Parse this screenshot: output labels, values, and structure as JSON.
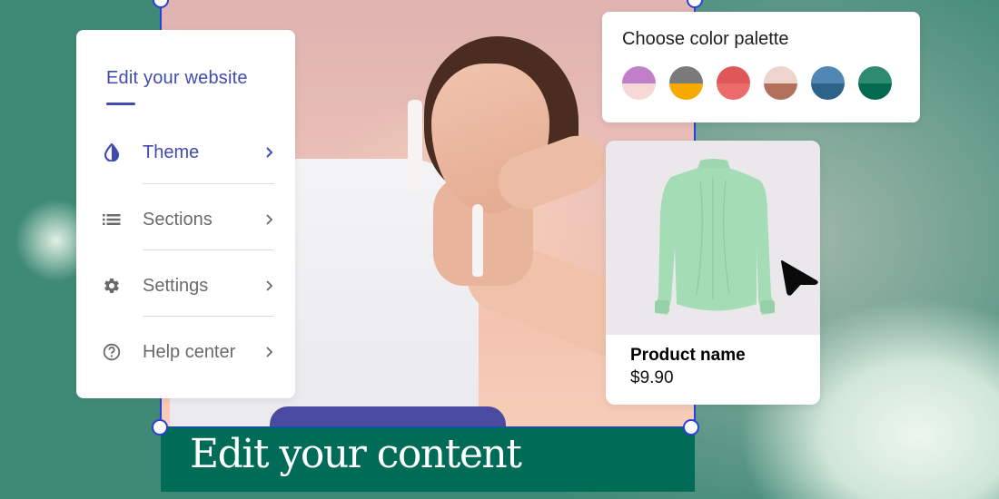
{
  "menu": {
    "title": "Edit your website",
    "items": [
      {
        "label": "Theme",
        "icon": "theme-drop-icon",
        "active": true
      },
      {
        "label": "Sections",
        "icon": "list-icon",
        "active": false
      },
      {
        "label": "Settings",
        "icon": "gear-icon",
        "active": false
      },
      {
        "label": "Help center",
        "icon": "help-circle-icon",
        "active": false
      }
    ]
  },
  "palette": {
    "title": "Choose color palette",
    "swatches": [
      {
        "name": "lilac",
        "top": "#c17fc9",
        "bottom": "#f6d9d6"
      },
      {
        "name": "gray-amber",
        "top": "#7a7a7a",
        "bottom": "#f8a900"
      },
      {
        "name": "coral",
        "top": "#df5858",
        "bottom": "#eb6b6d"
      },
      {
        "name": "blush-brown",
        "top": "#eed4cc",
        "bottom": "#b0705a"
      },
      {
        "name": "blue",
        "top": "#4f86b3",
        "bottom": "#2d6289"
      },
      {
        "name": "green",
        "top": "#2f8a72",
        "bottom": "#036a50"
      }
    ]
  },
  "product": {
    "name": "Product name",
    "price": "$9.90"
  },
  "banner": {
    "text": "Edit your content"
  },
  "colors": {
    "accent": "#3f4bb0",
    "selection": "#2a3fe0",
    "banner_bg": "#006b56"
  }
}
